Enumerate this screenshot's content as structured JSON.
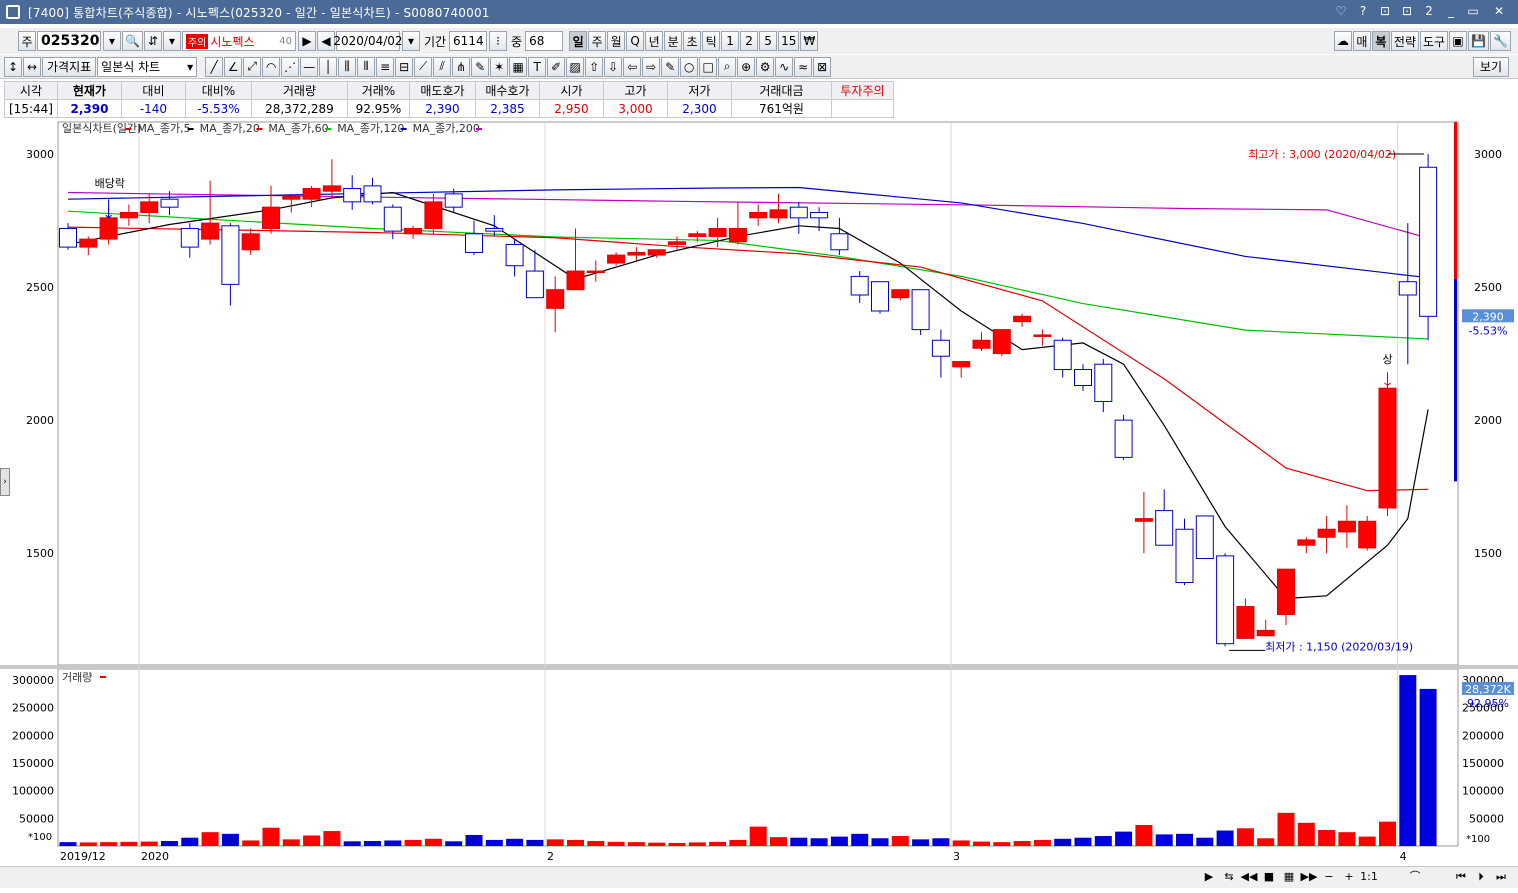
{
  "window": {
    "title": "[7400] 통합차트(주식종합) - 시노펙스(025320 - 일간 - 일본식차트) - S0080740001",
    "buttons": [
      "♡",
      "?",
      "⊡",
      "⊡",
      "2",
      "_",
      "▭",
      "✕"
    ]
  },
  "toolbar1": {
    "mode": "주",
    "code": "025320",
    "badge": "주의",
    "name": "시노펙스",
    "name_suffix": "40",
    "date": "2020/04/02",
    "period_label": "기간",
    "period_value": "6114",
    "count_label": "중",
    "count_value": "68",
    "intervals": [
      "일",
      "주",
      "월",
      "Q",
      "년",
      "분",
      "초",
      "틱",
      "1",
      "2",
      "5",
      "15",
      "₩"
    ],
    "active_interval": "일",
    "right": [
      "매",
      "복",
      "전략",
      "도구"
    ]
  },
  "toolbar2": {
    "indicator_btn": "가격지표",
    "chart_type": "일본식 차트",
    "view_btn": "보기"
  },
  "info": {
    "headers": [
      "시각",
      "현재가",
      "대비",
      "대비%",
      "거래량",
      "거래%",
      "매도호가",
      "매수호가",
      "시가",
      "고가",
      "저가",
      "거래대금",
      "투자주의"
    ],
    "values": [
      "[15:44]",
      "2,390",
      "-140",
      "-5.53%",
      "28,372,289",
      "92.95%",
      "2,390",
      "2,385",
      "2,950",
      "3,000",
      "2,300",
      "761억원",
      ""
    ]
  },
  "chart_data": {
    "type": "candlestick",
    "legend": [
      "일본식차트(일간)",
      "MA_종가,5",
      "MA_종가,20",
      "MA_종가,60",
      "MA_종가,120",
      "MA_종가,200"
    ],
    "legend_colors": [
      "#e00000",
      "#000000",
      "#e00000",
      "#00c000",
      "#0000c0",
      "#c000c0"
    ],
    "price_axis": {
      "ticks": [
        1500,
        2000,
        2500,
        3000
      ],
      "labels": [
        "1500",
        "2000",
        "2500",
        "3000"
      ],
      "range": [
        1080,
        3120
      ]
    },
    "volume_axis": {
      "ticks": [
        50000,
        100000,
        150000,
        200000,
        250000,
        300000
      ],
      "labels": [
        "50000",
        "100000",
        "150000",
        "200000",
        "250000",
        "300000"
      ],
      "range": [
        0,
        320000
      ],
      "unit_label": "*100",
      "title": "거래량"
    },
    "x_labels": [
      "2019/12",
      "2020",
      "2",
      "3",
      "4"
    ],
    "x_label_index": [
      0,
      4,
      24,
      44,
      66
    ],
    "annotations": {
      "high": "최고가 : 3,000 (2020/04/02)",
      "low": "최저가 : 1,150 (2020/03/19)",
      "dividend": "배당락",
      "limit_up": "상"
    },
    "current_price_label": "2,390",
    "current_change_label": "-5.53%",
    "current_volume_label": "28,372K",
    "current_volume_pct": "92.95%",
    "ma200": [
      2855,
      2838,
      2822,
      2808,
      2795,
      2790,
      2684
    ],
    "ma200_idx": [
      0,
      15,
      30,
      45,
      55,
      62,
      67
    ],
    "ma120": [
      2830,
      2852,
      2865,
      2872,
      2874,
      2816,
      2739,
      2615,
      2535
    ],
    "ma120_idx": [
      0,
      15,
      24,
      32,
      36,
      44,
      50,
      58,
      67
    ],
    "ma60": [
      2785,
      2720,
      2688,
      2675,
      2615,
      2540,
      2438,
      2338,
      2305
    ],
    "ma60_idx": [
      0,
      15,
      24,
      32,
      38,
      44,
      50,
      58,
      67
    ],
    "ma20": [
      2725,
      2705,
      2685,
      2652,
      2625,
      2575,
      2448,
      2155,
      1820,
      1735,
      1740
    ],
    "ma20_idx": [
      0,
      15,
      24,
      30,
      36,
      42,
      48,
      54,
      60,
      64,
      67
    ],
    "ma5": [
      2660,
      2735,
      2790,
      2835,
      2855,
      2730,
      2530,
      2620,
      2690,
      2730,
      2720,
      2590,
      2410,
      2265,
      2290,
      2210,
      1980,
      1600,
      1330,
      1340,
      1530,
      1630,
      2040
    ],
    "ma5_idx": [
      0,
      5,
      10,
      13,
      16,
      21,
      25,
      29,
      33,
      36,
      38,
      41,
      44,
      47,
      50,
      52,
      54,
      57,
      60,
      62,
      65,
      66,
      67
    ],
    "candles": [
      [
        2720,
        2740,
        2640,
        2650
      ],
      [
        2650,
        2690,
        2620,
        2680
      ],
      [
        2680,
        2800,
        2660,
        2760
      ],
      [
        2760,
        2810,
        2730,
        2780
      ],
      [
        2780,
        2850,
        2740,
        2820
      ],
      [
        2830,
        2860,
        2770,
        2800
      ],
      [
        2720,
        2740,
        2610,
        2650
      ],
      [
        2680,
        2900,
        2660,
        2740
      ],
      [
        2730,
        2740,
        2430,
        2510
      ],
      [
        2640,
        2720,
        2620,
        2700
      ],
      [
        2720,
        2880,
        2700,
        2800
      ],
      [
        2830,
        2850,
        2780,
        2840
      ],
      [
        2830,
        2880,
        2800,
        2870
      ],
      [
        2860,
        2980,
        2840,
        2880
      ],
      [
        2870,
        2920,
        2790,
        2820
      ],
      [
        2880,
        2910,
        2810,
        2820
      ],
      [
        2800,
        2810,
        2680,
        2710
      ],
      [
        2700,
        2730,
        2680,
        2720
      ],
      [
        2720,
        2850,
        2700,
        2820
      ],
      [
        2850,
        2870,
        2780,
        2800
      ],
      [
        2700,
        2750,
        2620,
        2630
      ],
      [
        2720,
        2770,
        2690,
        2710
      ],
      [
        2660,
        2680,
        2540,
        2580
      ],
      [
        2560,
        2640,
        2460,
        2460
      ],
      [
        2420,
        2540,
        2330,
        2490
      ],
      [
        2490,
        2720,
        2490,
        2560
      ],
      [
        2560,
        2600,
        2520,
        2560
      ],
      [
        2590,
        2630,
        2580,
        2620
      ],
      [
        2620,
        2650,
        2600,
        2630
      ],
      [
        2620,
        2640,
        2610,
        2640
      ],
      [
        2660,
        2690,
        2640,
        2670
      ],
      [
        2690,
        2710,
        2670,
        2700
      ],
      [
        2690,
        2760,
        2650,
        2720
      ],
      [
        2670,
        2820,
        2660,
        2720
      ],
      [
        2760,
        2810,
        2730,
        2780
      ],
      [
        2760,
        2850,
        2740,
        2790
      ],
      [
        2800,
        2820,
        2700,
        2760
      ],
      [
        2780,
        2800,
        2710,
        2760
      ],
      [
        2700,
        2760,
        2620,
        2640
      ],
      [
        2540,
        2560,
        2440,
        2470
      ],
      [
        2520,
        2520,
        2400,
        2410
      ],
      [
        2460,
        2490,
        2450,
        2490
      ],
      [
        2490,
        2490,
        2320,
        2340
      ],
      [
        2300,
        2340,
        2160,
        2240
      ],
      [
        2200,
        2220,
        2160,
        2220
      ],
      [
        2270,
        2330,
        2260,
        2300
      ],
      [
        2250,
        2340,
        2240,
        2340
      ],
      [
        2370,
        2400,
        2350,
        2390
      ],
      [
        2320,
        2340,
        2280,
        2320
      ],
      [
        2300,
        2310,
        2160,
        2190
      ],
      [
        2190,
        2210,
        2110,
        2130
      ],
      [
        2210,
        2230,
        2030,
        2070
      ],
      [
        2000,
        2020,
        1850,
        1860
      ],
      [
        1620,
        1730,
        1500,
        1630
      ],
      [
        1660,
        1740,
        1530,
        1530
      ],
      [
        1590,
        1630,
        1380,
        1390
      ],
      [
        1640,
        1640,
        1480,
        1480
      ],
      [
        1490,
        1500,
        1150,
        1160
      ],
      [
        1180,
        1330,
        1180,
        1300
      ],
      [
        1190,
        1250,
        1190,
        1210
      ],
      [
        1270,
        1440,
        1230,
        1440
      ],
      [
        1530,
        1560,
        1500,
        1550
      ],
      [
        1560,
        1640,
        1500,
        1590
      ],
      [
        1580,
        1680,
        1520,
        1620
      ],
      [
        1520,
        1640,
        1510,
        1620
      ],
      [
        1670,
        2140,
        1640,
        2120
      ],
      [
        2520,
        2740,
        2210,
        2470
      ],
      [
        2950,
        3000,
        2300,
        2390
      ]
    ],
    "volumes": [
      7000,
      6500,
      7000,
      7500,
      8000,
      9000,
      15000,
      25000,
      22000,
      10000,
      33000,
      12000,
      19000,
      27000,
      8500,
      9000,
      10000,
      11000,
      13000,
      8500,
      20000,
      11000,
      13000,
      11000,
      12000,
      11000,
      9000,
      7500,
      7000,
      6000,
      5500,
      6500,
      7500,
      11000,
      35000,
      16000,
      15000,
      14000,
      17000,
      22000,
      14000,
      18000,
      12000,
      14000,
      10000,
      8000,
      7000,
      9000,
      11000,
      13000,
      15000,
      18000,
      26000,
      38000,
      21000,
      22000,
      15000,
      28000,
      32000,
      14000,
      60000,
      42000,
      29000,
      25000,
      17000,
      44000,
      309000,
      284000
    ]
  }
}
